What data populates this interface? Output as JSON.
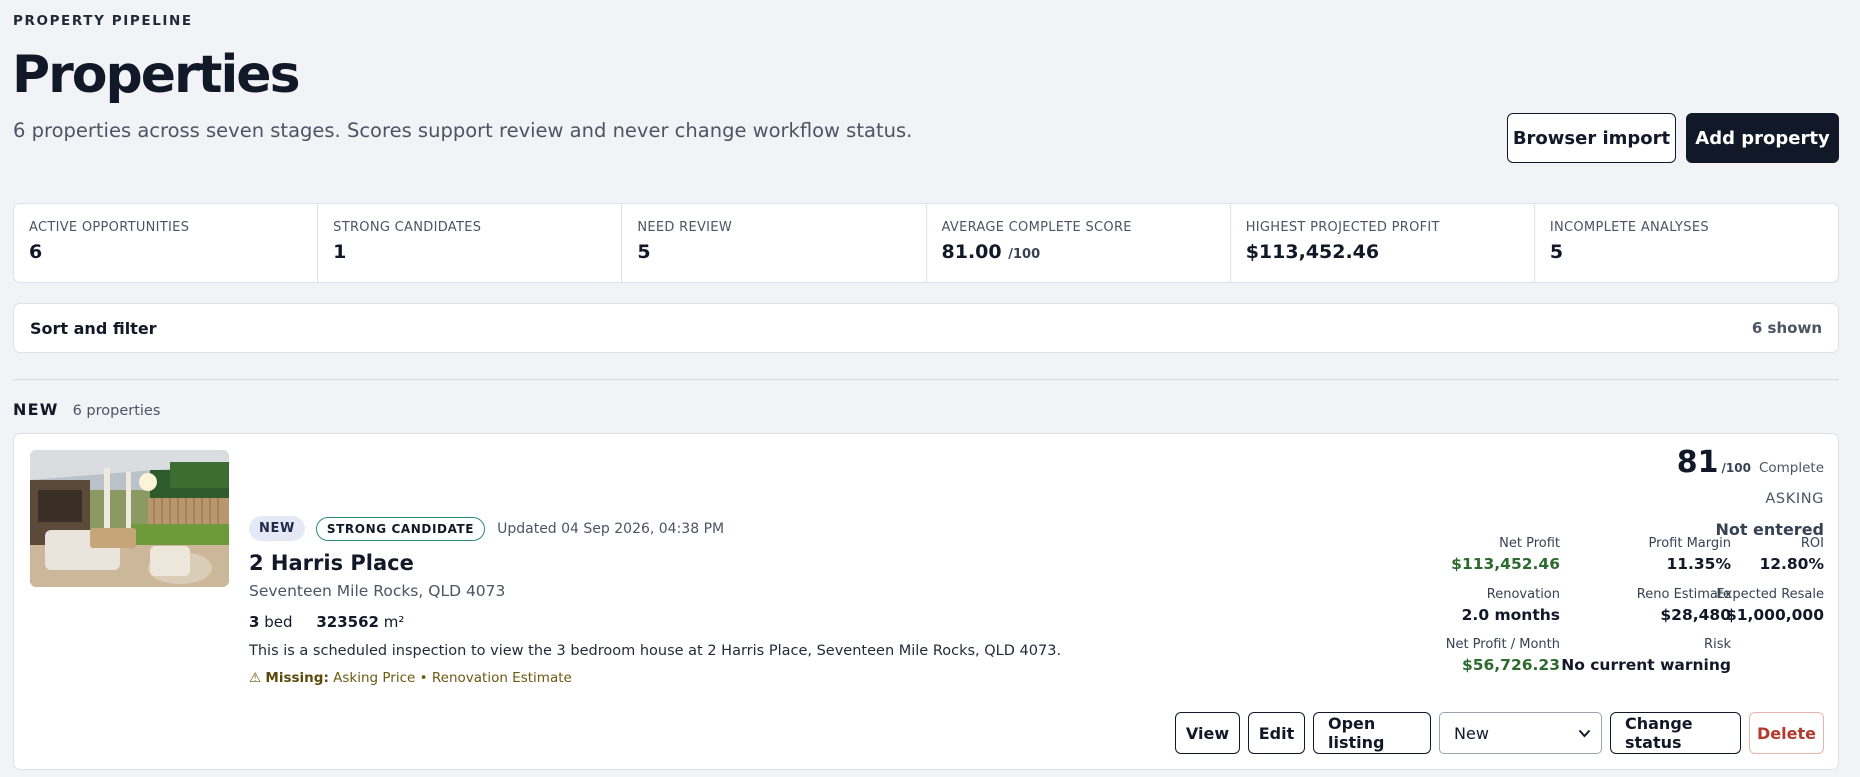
{
  "header": {
    "eyebrow": "PROPERTY PIPELINE",
    "title": "Properties",
    "subtitle": "6 properties across seven stages. Scores support review and never change workflow status.",
    "import_label": "Browser import",
    "add_label": "Add property"
  },
  "stats": [
    {
      "label": "ACTIVE OPPORTUNITIES",
      "value": "6",
      "suffix": ""
    },
    {
      "label": "STRONG CANDIDATES",
      "value": "1",
      "suffix": ""
    },
    {
      "label": "NEED REVIEW",
      "value": "5",
      "suffix": ""
    },
    {
      "label": "AVERAGE COMPLETE SCORE",
      "value": "81.00",
      "suffix": "/100"
    },
    {
      "label": "HIGHEST PROJECTED PROFIT",
      "value": "$113,452.46",
      "suffix": ""
    },
    {
      "label": "INCOMPLETE ANALYSES",
      "value": "5",
      "suffix": ""
    }
  ],
  "filter": {
    "title": "Sort and filter",
    "count": "6 shown"
  },
  "group": {
    "name": "NEW",
    "count": "6 properties"
  },
  "property": {
    "status_badge": "NEW",
    "candidate_badge": "STRONG CANDIDATE",
    "updated": "Updated 04 Sep 2026, 04:38 PM",
    "title": "2 Harris Place",
    "address": "Seventeen Mile Rocks, QLD 4073",
    "beds": "3",
    "beds_label": "bed",
    "area": "323562",
    "area_unit": "m²",
    "description": "This is a scheduled inspection to view the 3 bedroom house at 2 Harris Place, Seventeen Mile Rocks, QLD 4073.",
    "missing_icon": "⚠",
    "missing_label": "Missing:",
    "missing_items": "Asking Price • Renovation Estimate",
    "score": "81",
    "score_max": "/100",
    "score_status": "Complete",
    "asking_label": "ASKING",
    "asking_value": "Not entered",
    "metrics": {
      "net_profit": {
        "label": "Net Profit",
        "value": "$113,452.46"
      },
      "profit_margin": {
        "label": "Profit Margin",
        "value": "11.35%"
      },
      "roi": {
        "label": "ROI",
        "value": "12.80%"
      },
      "renovation": {
        "label": "Renovation",
        "value": "2.0 months"
      },
      "reno_estimate": {
        "label": "Reno Estimate",
        "value": "$28,480"
      },
      "expected_resale": {
        "label": "Expected Resale",
        "value": "$1,000,000"
      },
      "net_profit_month": {
        "label": "Net Profit / Month",
        "value": "$56,726.23"
      },
      "risk": {
        "label": "Risk",
        "value": "No current warning"
      }
    },
    "actions": {
      "view": "View",
      "edit": "Edit",
      "open_listing": "Open listing",
      "status_value": "New",
      "change_status": "Change status",
      "delete": "Delete"
    }
  },
  "colors": {
    "accent_dark": "#111827",
    "profit_green": "#2d6a2d",
    "delete_red": "#b33a2a",
    "strong_candidate_border": "#2f8a7a"
  }
}
